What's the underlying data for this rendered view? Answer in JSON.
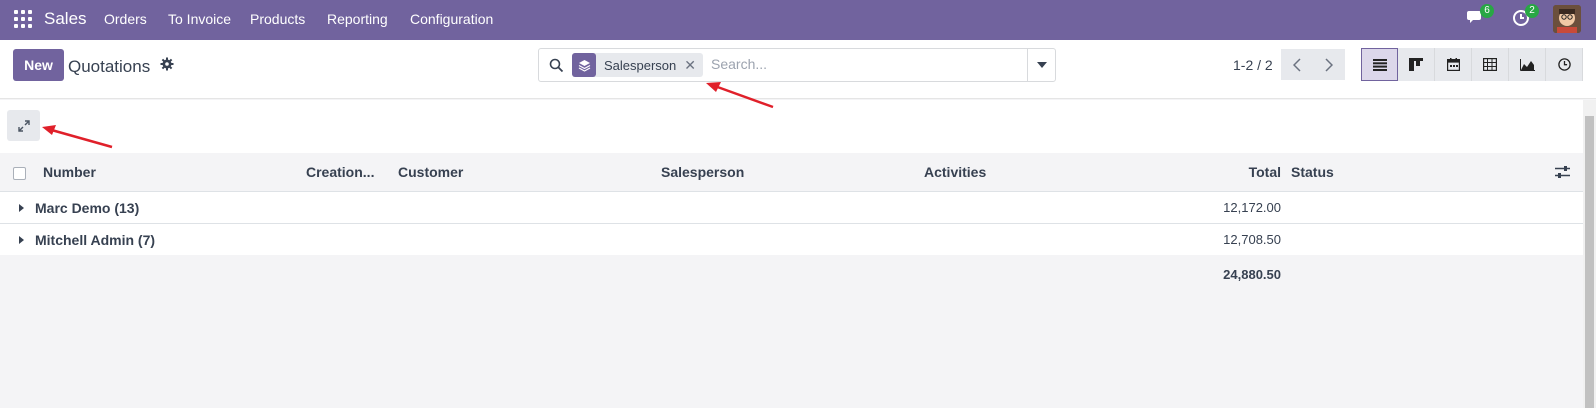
{
  "navbar": {
    "app_name": "Sales",
    "menu": [
      "Orders",
      "To Invoice",
      "Products",
      "Reporting",
      "Configuration"
    ],
    "messages_count": "6",
    "activities_count": "2",
    "bg_color": "#71639e"
  },
  "control": {
    "new_label": "New",
    "title": "Quotations",
    "facet_label": "Salesperson",
    "search_placeholder": "Search...",
    "pager": "1-2 / 2"
  },
  "table": {
    "columns": {
      "number": "Number",
      "creation": "Creation...",
      "customer": "Customer",
      "salesperson": "Salesperson",
      "activities": "Activities",
      "total": "Total",
      "status": "Status"
    },
    "groups": [
      {
        "name": "Marc Demo (13)",
        "total": "12,172.00"
      },
      {
        "name": "Mitchell Admin (7)",
        "total": "12,708.50"
      }
    ],
    "grand_total": "24,880.50"
  },
  "icons": {
    "apps": "apps-grid-icon",
    "search": "search-icon",
    "facet": "layers-icon",
    "expand": "expand-icon"
  },
  "annotation_color": "#e0202a"
}
